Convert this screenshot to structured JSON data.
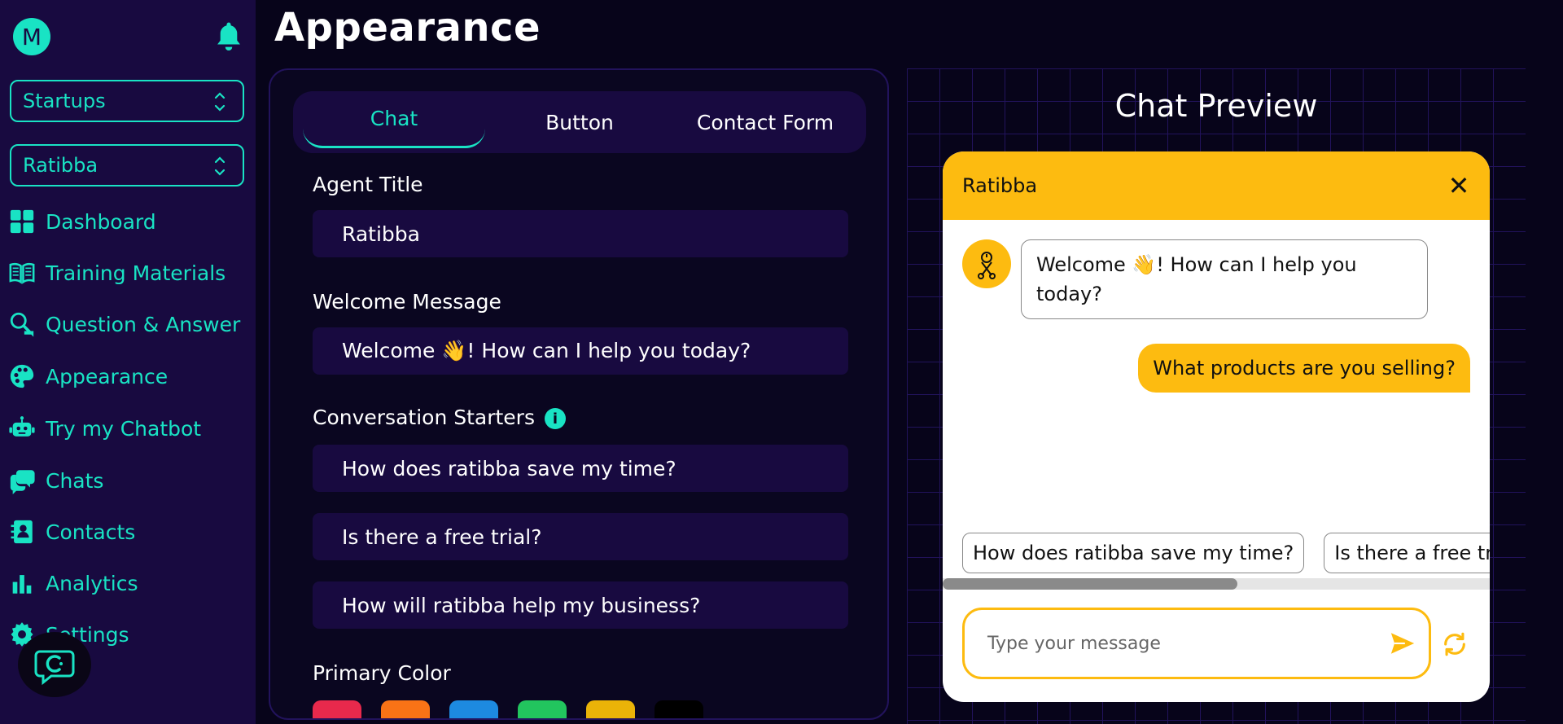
{
  "user": {
    "avatar_letter": "M"
  },
  "sidebar": {
    "org_select": "Startups",
    "agent_select": "Ratibba",
    "items": [
      {
        "label": "Dashboard",
        "icon": "dashboard-icon"
      },
      {
        "label": "Training Materials",
        "icon": "book-icon"
      },
      {
        "label": "Question & Answer",
        "icon": "qa-icon"
      },
      {
        "label": "Appearance",
        "icon": "palette-icon"
      },
      {
        "label": "Try my Chatbot",
        "icon": "robot-icon"
      },
      {
        "label": "Chats",
        "icon": "chat-icon"
      },
      {
        "label": "Contacts",
        "icon": "contacts-icon"
      },
      {
        "label": "Analytics",
        "icon": "analytics-icon"
      },
      {
        "label": "Settings",
        "icon": "gear-icon"
      }
    ]
  },
  "page": {
    "title": "Appearance"
  },
  "tabs": [
    {
      "label": "Chat",
      "active": true
    },
    {
      "label": "Button",
      "active": false
    },
    {
      "label": "Contact Form",
      "active": false
    }
  ],
  "form": {
    "agent_title_label": "Agent Title",
    "agent_title_value": "Ratibba",
    "welcome_label": "Welcome Message",
    "welcome_value": "Welcome 👋! How can I help you today?",
    "starters_label": "Conversation Starters",
    "starters": [
      "How does ratibba save my time?",
      "Is there a free trial?",
      "How will ratibba help my business?"
    ],
    "primary_color_label": "Primary Color",
    "swatches": [
      "#e8294c",
      "#f97316",
      "#1d8ae0",
      "#22c55e",
      "#eab308",
      "#000000"
    ]
  },
  "preview": {
    "title": "Chat Preview",
    "header_title": "Ratibba",
    "bot_message": "Welcome 👋! How can I help you today?",
    "user_message": "What products are you selling?",
    "starter_chips": [
      "How does ratibba save my time?",
      "Is there a free trial?"
    ],
    "input_placeholder": "Type your message"
  },
  "colors": {
    "accent": "#19e3c4",
    "sidebar_bg": "#180a40",
    "page_bg": "#07041a",
    "chat_primary": "#fdbb10"
  }
}
